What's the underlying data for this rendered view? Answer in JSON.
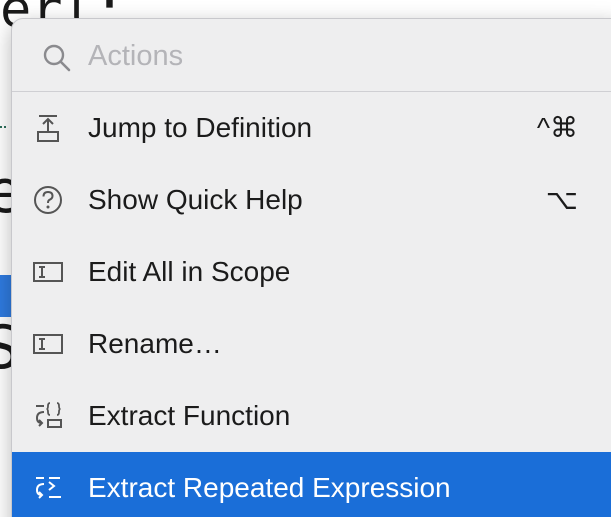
{
  "background": {
    "code_top": "erl:",
    "code_mid": "e",
    "code_low": "S"
  },
  "search": {
    "placeholder": "Actions",
    "value": ""
  },
  "menu": {
    "items": [
      {
        "label": "Jump to Definition",
        "shortcut": "^⌘",
        "icon": "jump-to-definition-icon"
      },
      {
        "label": "Show Quick Help",
        "shortcut": "⌥",
        "icon": "question-circle-icon"
      },
      {
        "label": "Edit All in Scope",
        "shortcut": "",
        "icon": "text-cursor-box-icon"
      },
      {
        "label": "Rename…",
        "shortcut": "",
        "icon": "text-cursor-box-icon"
      },
      {
        "label": "Extract Function",
        "shortcut": "",
        "icon": "extract-function-icon"
      },
      {
        "label": "Extract Repeated Expression",
        "shortcut": "",
        "icon": "extract-expression-icon",
        "selected": true
      }
    ]
  },
  "colors": {
    "selection": "#1a6ed8",
    "popup_background": "#eeeeef",
    "placeholder": "#b4b4b8"
  }
}
